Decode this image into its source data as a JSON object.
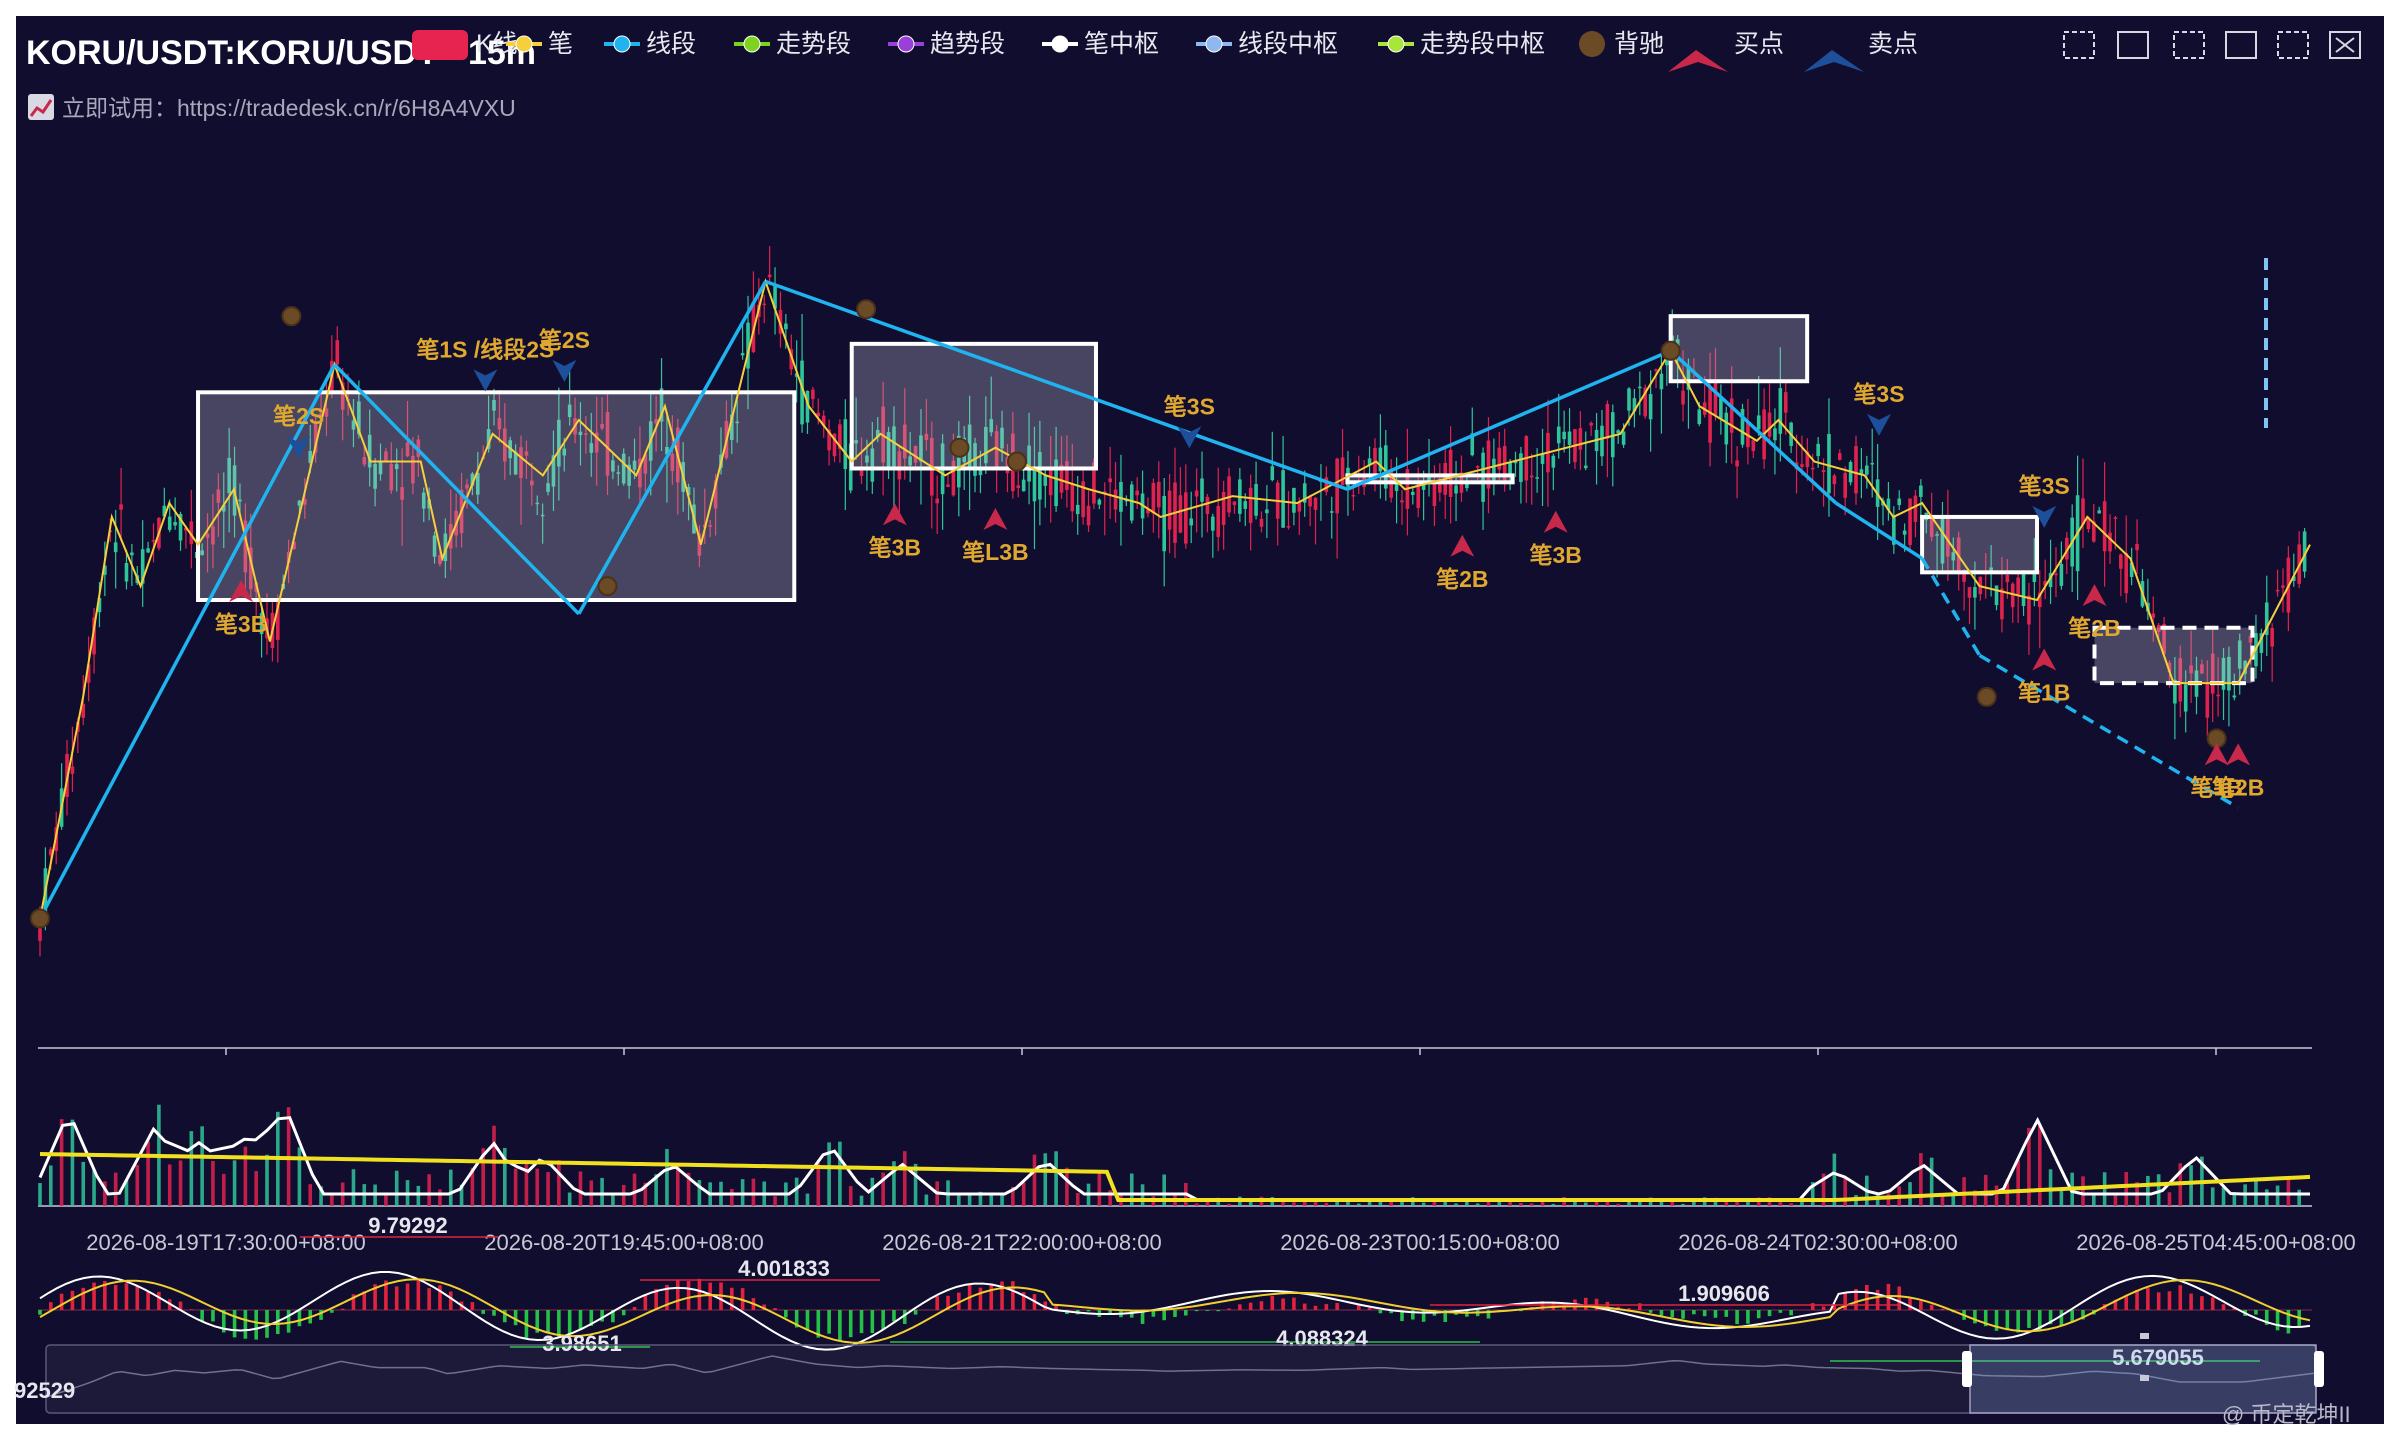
{
  "title": "KORU/USDT:KORU/USDT - 15m",
  "subtitle": "立即试用：https://tradedesk.cn/r/6H8A4VXU",
  "subtitle_icon": "chart-emoji-icon",
  "watermark": "@ 币定乾坤II",
  "colors": {
    "background": "#110d2e",
    "bi": "#f5d03a",
    "segment": "#1fb4f0",
    "trend_segment": "#7ed321",
    "trend": "#9a3fd8",
    "bi_pivot": "#ffffff",
    "segment_pivot": "#8fb8f0",
    "trend_pivot": "#a8e63a",
    "divergence": "#5a4020",
    "buy": "#c8284a",
    "sell": "#1d4f9a",
    "up_candle": "#2fc59a",
    "down_candle": "#e0234e",
    "signal_label": "#e0a82e"
  },
  "legend": [
    {
      "label": "K线",
      "icon": "candle-badge"
    },
    {
      "label": "笔",
      "icon": "line-dot-yellow"
    },
    {
      "label": "线段",
      "icon": "line-dot-cyan"
    },
    {
      "label": "走势段",
      "icon": "line-dot-green"
    },
    {
      "label": "趋势段",
      "icon": "line-dot-purple"
    },
    {
      "label": "笔中枢",
      "icon": "line-dot-white"
    },
    {
      "label": "线段中枢",
      "icon": "line-dot-lightblue"
    },
    {
      "label": "走势段中枢",
      "icon": "line-dot-lime"
    },
    {
      "label": "背驰",
      "icon": "brown-circle"
    },
    {
      "label": "买点",
      "icon": "buy-arrow"
    },
    {
      "label": "卖点",
      "icon": "sell-arrow"
    }
  ],
  "toolbar": [
    {
      "name": "zoom-select-icon"
    },
    {
      "name": "lasso-icon"
    },
    {
      "name": "zoom-reset-icon"
    },
    {
      "name": "expand-icon"
    },
    {
      "name": "restore-icon"
    },
    {
      "name": "close-zoom-icon"
    }
  ],
  "chart_data": {
    "type": "line",
    "x_ticks": [
      "2026-08-19T17:30:00+08:00",
      "2026-08-20T19:45:00+08:00",
      "2026-08-21T22:00:00+08:00",
      "2026-08-23T00:15:00+08:00",
      "2026-08-24T02:30:00+08:00",
      "2026-08-25T04:45:00+08:00"
    ],
    "bi": [
      [
        0,
        5.9
      ],
      [
        6,
        7.5
      ],
      [
        10,
        8.8
      ],
      [
        14,
        8.3
      ],
      [
        18,
        8.9
      ],
      [
        22,
        8.6
      ],
      [
        27,
        9.0
      ],
      [
        32,
        7.9
      ],
      [
        41,
        9.9
      ],
      [
        46,
        9.2
      ],
      [
        53,
        9.2
      ],
      [
        56,
        8.5
      ],
      [
        63,
        9.4
      ],
      [
        70,
        9.1
      ],
      [
        75,
        9.5
      ],
      [
        83,
        9.1
      ],
      [
        87,
        9.6
      ],
      [
        92,
        8.6
      ],
      [
        101,
        10.5
      ],
      [
        107,
        9.6
      ],
      [
        113,
        9.2
      ],
      [
        117,
        9.4
      ],
      [
        126,
        9.1
      ],
      [
        133,
        9.3
      ],
      [
        140,
        9.1
      ],
      [
        146,
        9.0
      ],
      [
        153,
        8.9
      ],
      [
        156,
        8.8
      ],
      [
        166,
        8.95
      ],
      [
        175,
        8.9
      ],
      [
        186,
        9.2
      ],
      [
        190,
        9.0
      ],
      [
        205,
        9.2
      ],
      [
        220,
        9.4
      ],
      [
        227,
        10.0
      ],
      [
        231,
        9.6
      ],
      [
        239,
        9.35
      ],
      [
        242,
        9.5
      ],
      [
        247,
        9.2
      ],
      [
        254,
        9.1
      ],
      [
        258,
        8.8
      ],
      [
        262,
        8.9
      ],
      [
        270,
        8.3
      ],
      [
        278,
        8.2
      ],
      [
        285,
        8.8
      ],
      [
        291,
        8.5
      ],
      [
        297,
        7.6
      ],
      [
        306,
        7.6
      ],
      [
        316,
        8.6
      ]
    ],
    "segment": [
      [
        0,
        5.9
      ],
      [
        41,
        9.9
      ],
      [
        75,
        8.1
      ],
      [
        101,
        10.5
      ],
      [
        182,
        9.0
      ],
      [
        227,
        10.0
      ],
      [
        250,
        8.9
      ],
      [
        262,
        8.5
      ],
      [
        270,
        7.8
      ],
      [
        306,
        6.7
      ]
    ],
    "bi_pivots": [
      {
        "t0": 22,
        "t1": 105,
        "low": 8.2,
        "high": 9.7
      },
      {
        "t0": 113,
        "t1": 147,
        "low": 9.15,
        "high": 10.05
      },
      {
        "t0": 182,
        "t1": 205,
        "low": 9.05,
        "high": 9.1
      },
      {
        "t0": 227,
        "t1": 246,
        "low": 9.78,
        "high": 10.25
      },
      {
        "t0": 262,
        "t1": 278,
        "low": 8.4,
        "high": 8.8
      },
      {
        "t0": 286,
        "t1": 308,
        "low": 7.6,
        "high": 8.0
      }
    ],
    "divergence": [
      [
        0,
        5.9
      ],
      [
        35,
        10.25
      ],
      [
        79,
        8.3
      ],
      [
        115,
        10.3
      ],
      [
        128,
        9.3
      ],
      [
        136,
        9.2
      ],
      [
        227,
        10.0
      ],
      [
        271,
        7.5
      ],
      [
        303,
        7.2
      ]
    ],
    "signals": [
      {
        "t": 28,
        "label": "笔3B",
        "type": "buy"
      },
      {
        "t": 36,
        "label": "笔2S",
        "type": "sell"
      },
      {
        "t": 62,
        "label": "笔1S /线段2S",
        "type": "sell"
      },
      {
        "t": 73,
        "label": "笔2S",
        "type": "sell"
      },
      {
        "t": 119,
        "label": "笔3B",
        "type": "buy"
      },
      {
        "t": 133,
        "label": "笔L3B",
        "type": "buy"
      },
      {
        "t": 160,
        "label": "笔3S",
        "type": "sell"
      },
      {
        "t": 198,
        "label": "笔2B",
        "type": "buy"
      },
      {
        "t": 211,
        "label": "笔3B",
        "type": "buy"
      },
      {
        "t": 256,
        "label": "笔3S",
        "type": "sell"
      },
      {
        "t": 279,
        "label": "笔3S",
        "type": "sell"
      },
      {
        "t": 279,
        "label": "笔1B",
        "type": "buy"
      },
      {
        "t": 286,
        "label": "笔2B",
        "type": "buy"
      },
      {
        "t": 303,
        "label": "笔1B",
        "type": "buy"
      },
      {
        "t": 306,
        "label": "笔2B",
        "type": "buy"
      }
    ],
    "macd_labels": [
      "9.79292",
      "4.001833",
      "1.909606",
      "3.98651",
      "4.088324",
      "5.679055"
    ],
    "slider_left_label": "92529"
  }
}
